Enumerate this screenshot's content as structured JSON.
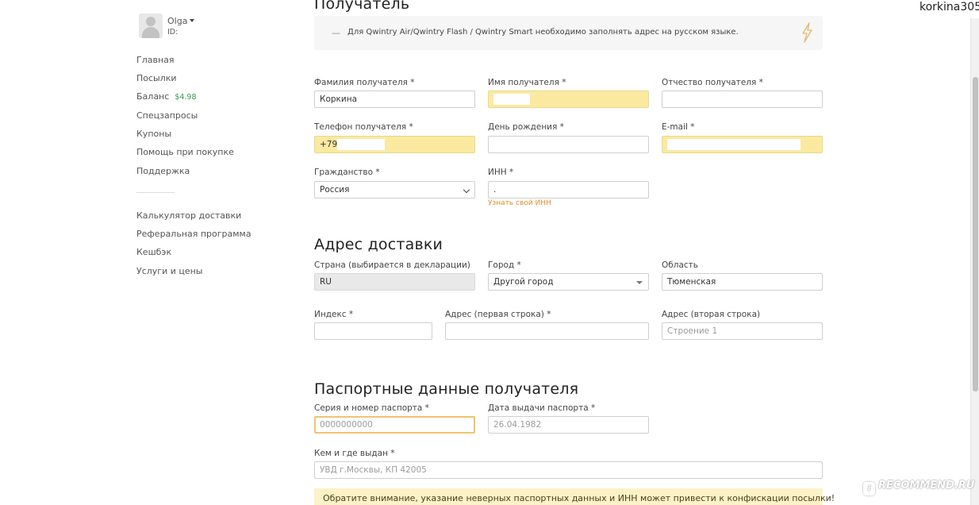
{
  "header": {
    "username": "korkina305"
  },
  "sidebar": {
    "user": {
      "name": "Olga",
      "id_label": "ID:"
    },
    "nav": [
      {
        "label": "Главная"
      },
      {
        "label": "Посылки"
      },
      {
        "label": "Баланс",
        "badge": "$4.98"
      },
      {
        "label": "Спецзапросы"
      },
      {
        "label": "Купоны"
      },
      {
        "label": "Помощь при покупке"
      },
      {
        "label": "Поддержка"
      }
    ],
    "nav2": [
      {
        "label": "Калькулятор доставки"
      },
      {
        "label": "Реферальная программа"
      },
      {
        "label": "Кешбэк"
      },
      {
        "label": "Услуги и цены"
      }
    ]
  },
  "recipient": {
    "title": "Получатель",
    "note_dash": "—",
    "note": "Для Qwintry Air/Qwintry Flash / Qwintry Smart необходимо заполнять адрес на русском языке.",
    "lastname": {
      "label": "Фамилия получателя *",
      "value": "Коркина"
    },
    "firstname": {
      "label": "Имя получателя *",
      "value": ""
    },
    "middlename": {
      "label": "Отчество получателя *",
      "value": ""
    },
    "phone": {
      "label": "Телефон получателя *",
      "value": "+79"
    },
    "birthday": {
      "label": "День рождения *",
      "value": ""
    },
    "email": {
      "label": "E-mail *",
      "value": ""
    },
    "citizenship": {
      "label": "Гражданство *",
      "value": "Россия"
    },
    "inn": {
      "label": "ИНН *",
      "value": ".",
      "hint": "Узнать свой ИНН"
    }
  },
  "address": {
    "title": "Адрес доставки",
    "country": {
      "label": "Страна (выбирается в декларации)",
      "value": "RU"
    },
    "city": {
      "label": "Город *",
      "value": "Другой город"
    },
    "region": {
      "label": "Область",
      "value": "Тюменская"
    },
    "zip": {
      "label": "Индекс *",
      "value": ""
    },
    "line1": {
      "label": "Адрес (первая строка) *",
      "value": ""
    },
    "line2": {
      "label": "Адрес (вторая строка)",
      "placeholder": "Строение 1"
    }
  },
  "passport": {
    "title": "Паспортные данные получателя",
    "number": {
      "label": "Серия и номер паспорта *",
      "placeholder": "0000000000"
    },
    "issue_date": {
      "label": "Дата выдачи паспорта *",
      "placeholder": "26.04.1982"
    },
    "issued_by": {
      "label": "Кем и где выдан *",
      "placeholder": "УВД г.Москвы, КП 42005"
    },
    "warning": "Обратите внимание, указание неверных паспортных данных и ИНН может привести к конфискации посылки!"
  },
  "watermark": {
    "text": "RECOMMEND.RU",
    "logo_letter": "i"
  },
  "colors": {
    "highlight_yellow": "#fbe9a0",
    "hint_orange": "#e08d2a",
    "badge_green": "#2e9e4e",
    "warning_bg": "#fcf2c7"
  }
}
